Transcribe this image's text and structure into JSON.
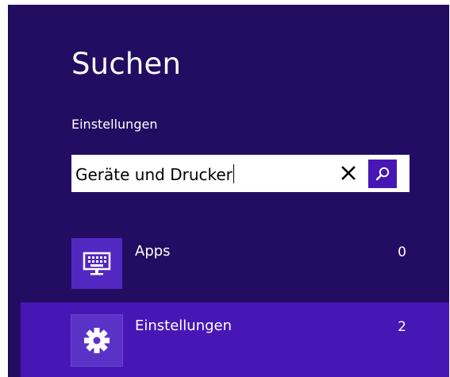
{
  "search_pane": {
    "title": "Suchen",
    "scope_label": "Einstellungen",
    "query": "Geräte und Drucker",
    "icons": {
      "clear": "close-icon",
      "search": "magnifier-icon"
    }
  },
  "results": [
    {
      "label": "Apps",
      "count": "0",
      "icon": "keyboard-monitor-icon",
      "selected": false
    },
    {
      "label": "Einstellungen",
      "count": "2",
      "icon": "gear-icon",
      "selected": true
    }
  ],
  "colors": {
    "pane_background": "#220d62",
    "accent": "#4617b4",
    "tile": "#5228c2",
    "text": "#ffffff"
  }
}
